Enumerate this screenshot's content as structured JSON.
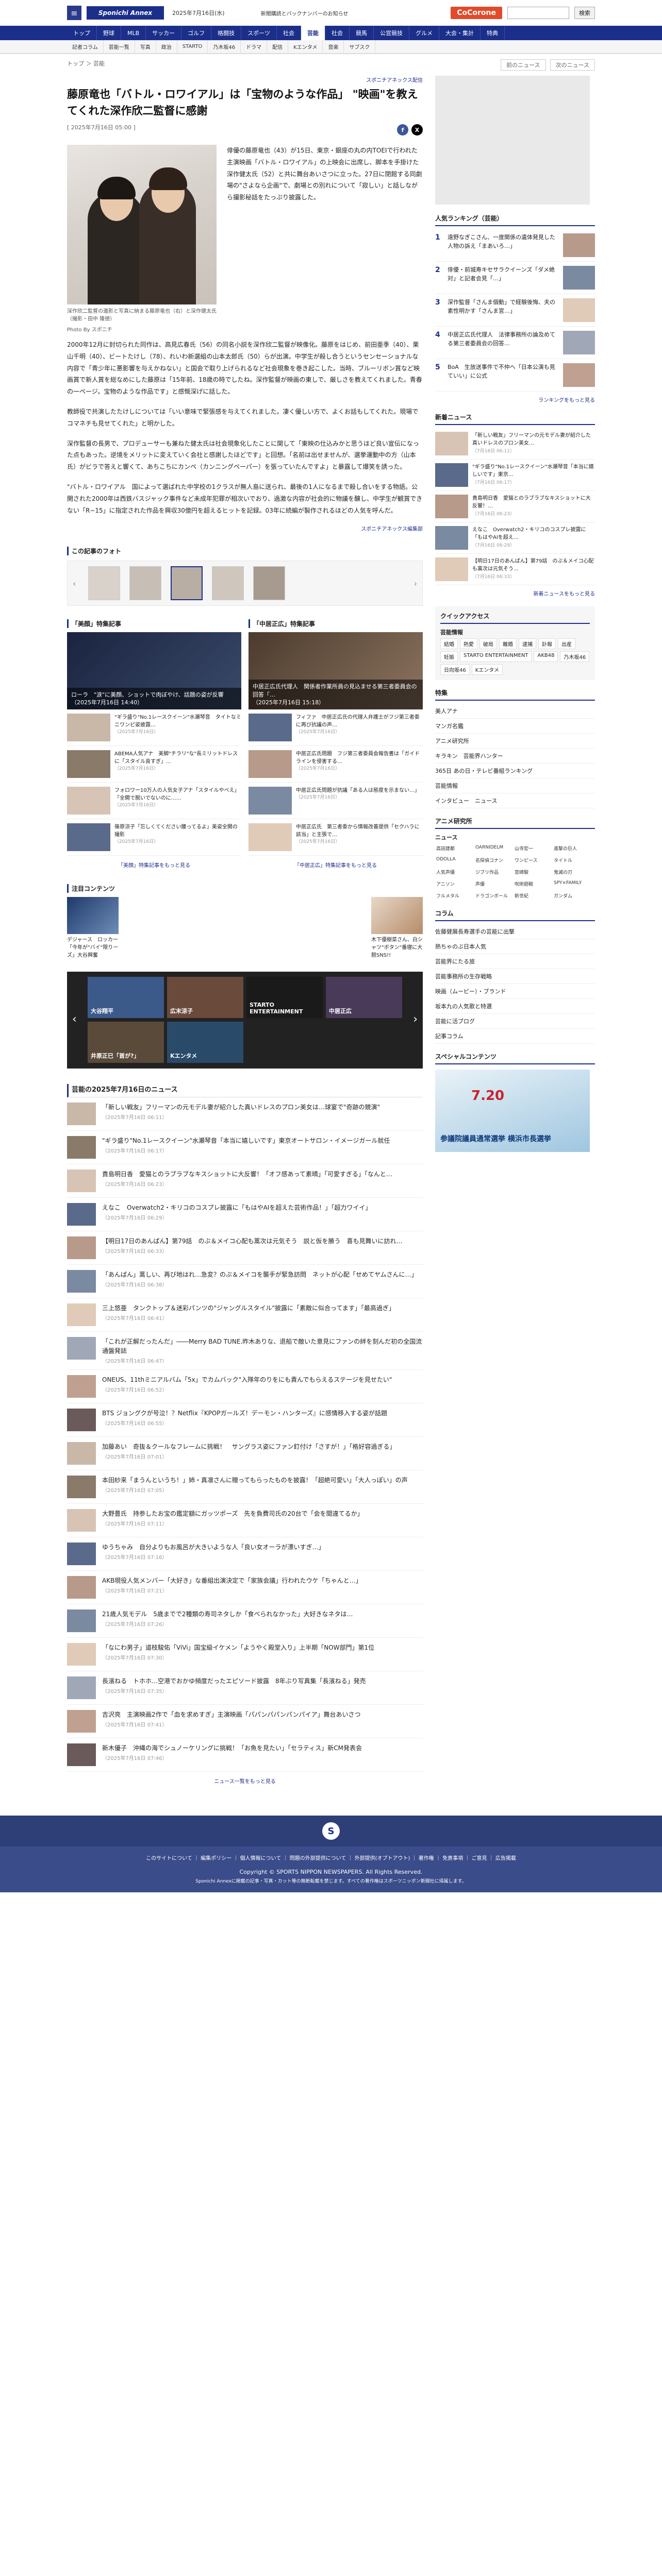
{
  "header": {
    "logo": "Sponichi Annex",
    "date": "2025年7月16日(水)",
    "promo": "新聞購読とバックナンバーのお知らせ",
    "cocorone": "CoCorone",
    "search_label": "検索"
  },
  "nav_main": [
    "トップ",
    "野球",
    "MLB",
    "サッカー",
    "ゴルフ",
    "格闘技",
    "スポーツ",
    "社会",
    "芸能",
    "社会",
    "競馬",
    "公営競技",
    "グルメ",
    "大会・集計",
    "特典"
  ],
  "nav_sub": [
    "記者コラム",
    "芸能一覧",
    "写真",
    "政治",
    "STARTO",
    "乃木坂46",
    "ドラマ",
    "配信",
    "Kエンタメ",
    "音楽",
    "サブスク"
  ],
  "breadcrumb": "トップ ＞ 芸能",
  "pager": {
    "prev": "前のニュース",
    "next": "次のニュース"
  },
  "article": {
    "sponsor": "スポニチアネックス配信",
    "title": "藤原竜也「バトル・ロワイアル」は「宝物のような作品」 \"映画\"を教えてくれた深作欣二監督に感謝",
    "date": "[ 2025年7月16日 05:00 ]",
    "caption": "深作欣二監督の遺影と写真に納まる藤原竜也（右）と深作健太氏（撮影・田中 隆徳）",
    "photo_by": "Photo By スポニチ",
    "paragraphs": [
      "俳優の藤原竜也（43）が15日、東京・銀座の丸の内TOEIで行われた主演映画「バトル・ロワイアル」の上映会に出席し、脚本を手掛けた深作健太氏（52）と共に舞台あいさつに立った。27日に閉館する同劇場の\"さよなら企画\"で、劇場との別れについて「寂しい」と話しながら撮影秘話をたっぷり披露した。",
      "2000年12月に封切られた同作は、高見広春氏（56）の同名小説を深作欣二監督が映像化。藤原をはじめ、前田亜季（40）、栗山千明（40）、ビートたけし（78）、れいわ新選組の山本太郎氏（50）らが出演。中学生が殺し合うというセンセーショナルな内容で「青少年に悪影響を与えかねない」と国会で取り上げられるなど社会現象を巻き起こした。当時、ブルーリボン賞など映画賞で新人賞を総なめにした藤原は「15年前、18歳の時でしたね。深作監督が映画の東しで、厳しさを教えてくれました。青春の一ページ。宝物のような作品です」と感慨深げに話した。",
      "教師役で共演したたけしについては「いい意味で緊張感を与えてくれました。凄く優しい方で、よくお話もしてくれた。現場でコマネチも見せてくれた」と明かした。",
      "深作監督の長男で、プロデューサーも兼ねた健太氏は社会現象化したことに関して「東映の仕込みかと思うほど良い宣伝になった点もあった。逆境をメリットに変えていく会社と感謝したほどです」と回想。「名前は出せませんが、選挙運動中の方（山本氏）がビラで答えと響くて、あちこちにカンペ（カンニングペーパー）を張っていたんですよ」と暴露して爆笑を誘った。",
      "\"バトル・ロワイアル　国によって選ばれた中学校の1クラスが無人島に送られ、最後の1人になるまで殺し合いをする物語。公開された2000年は西鉄バスジャック事件など未成年犯罪が相次いでおり、過激な内容が社会的に物議を醸し、中学生が観賞できない「R−15」に指定された作品を興収30億円を超えるヒットを記録。03年に続編が製作されるほどの人気を呼んだ。"
    ],
    "credit": "スポニチアネックス編集部"
  },
  "gallery": {
    "heading": "この記事のフォト"
  },
  "features": [
    {
      "heading": "「美顔」特集記事",
      "main_caption": "ローラ　\"涙\"に美顔、ショットで肉ぼやけ、話題の姿が反響",
      "main_date": "（2025年7月16日 14:40）",
      "items": [
        {
          "text": "\"ギラ盛り\"No.1レースクイーン\"水瀬琴音　タイトなミニワンピ姿披露…",
          "date": "（2025年7月16日）"
        },
        {
          "text": "ABEMA人気アナ　美脚\"チラリ\"な\"長ミリットドレスに「スタイル良すぎ」…",
          "date": "（2025年7月16日）"
        },
        {
          "text": "フォロワー10万人の人気女子アナ「スタイルやべえ」「全開で脱いでないのに……",
          "date": "（2025年7月16日）"
        },
        {
          "text": "篠原涼子「忘しくてください腰ってるよ」美姿全開の撮影",
          "date": "（2025年7月16日）"
        }
      ],
      "more": "「美顔」特集記事をもっと見る"
    },
    {
      "heading": "「中居正広」特集記事",
      "main_caption": "中居正広氏代理人　関係者作業所員の見込ませる第三者委員会の回答「…",
      "main_date": "（2025年7月16日 15:18）",
      "items": [
        {
          "text": "フィファ　中居正広氏の代理人弁護士がフジ第三者委に再び抗議の声…",
          "date": "（2025年7月16日）"
        },
        {
          "text": "中居正広氏問題　フジ第三者委員会報告書は「ガイドラインを侵害する…",
          "date": "（2025年7月16日）"
        },
        {
          "text": "中居正広氏問題が抗議「ある人は態度を示まない…」",
          "date": "（2025年7月16日）"
        },
        {
          "text": "中居正広氏　第三者委から情報改善提供「セクハラに該当」と主張で…",
          "date": "（2025年7月16日）"
        }
      ],
      "more": "「中居正広」特集記事をもっと見る"
    }
  ],
  "attention": {
    "heading": "注目コンテンツ",
    "items": [
      {
        "text": "デジャース　ロッカー「今年が\"バイ\"限りーズ」大谷興奮"
      },
      {
        "text": "木下優樹菜さん、白シャツ\"ボタン\"番寝に大胆SNS!!"
      }
    ]
  },
  "carousel": [
    "大谷翔平",
    "広末涼子",
    "STARTO ENTERTAINMENT",
    "中居正広",
    "井原正巳「首が?」",
    "Kエンタメ"
  ],
  "news": {
    "heading": "芸能の2025年7月16日のニュース",
    "items": [
      {
        "text": "「新しい戦友」フリーマンの元モデル妻が紹介した真いドレスのプロン美女は…球宴で\"奇跡の競演\"",
        "date": "（2025年7月16日 06:11）"
      },
      {
        "text": "\"ギラ盛り\"No.1レースクイーン\"水瀬琴音「本当に嬉しいです」東京オートサロン・イメージガール就任",
        "date": "（2025年7月16日 06:17）"
      },
      {
        "text": "貴島明日香　愛猫とのラブラブなキスショットに大反響！「オフ感あって素晴」「可愛すぎる」「なんと…",
        "date": "（2025年7月16日 06:23）"
      },
      {
        "text": "えなこ　Overwatch2・キリコのコスプレ披露に「もはやAIを超えた芸術作品！」「超力ワイイ」",
        "date": "（2025年7月16日 06:29）"
      },
      {
        "text": "【明日17日のあんぱん】第79話　のぶ＆メイコ心配も蒿次は元気そう　説と仮を勝う　喜も見舞いに訪れ…",
        "date": "（2025年7月16日 06:33）"
      },
      {
        "text": "「あんぱん」蒿しい、再び地はれ…急変？のぶ＆メイコを襲手が緊急訪問　ネットが心配「せめてヤムさんに…」",
        "date": "（2025年7月16日 06:38）"
      },
      {
        "text": "三上悠亜　タンクトップ＆迷彩パンツの\"ジャングルスタイル\"披露に「素敵に似合ってます」「最高過ぎ」",
        "date": "（2025年7月16日 06:41）"
      },
      {
        "text": "「これが正解だったんだ」――Merry BAD TUNE.昨木ありな、退船で敵いた意見にファンの絆を刻んだ初の全国流通盤発誌",
        "date": "（2025年7月16日 06:47）"
      },
      {
        "text": "ONEUS、11thミニアルバム「5x」でカムバック\"入隊年のりをにも責んでもらえるステージを見せたい\"",
        "date": "（2025年7月16日 06:52）"
      },
      {
        "text": "BTS ジョングクが号泣！？Netflix『KPOPガールズ！デーモン・ハンターズ』に感情移入する姿が話題",
        "date": "（2025年7月16日 06:55）"
      },
      {
        "text": "加藤あい　奇抜＆クールなフレームに挑戦！　サングラス姿にファン釘付け「さすが！」「格好容過ぎる」",
        "date": "（2025年7月16日 07:01）"
      },
      {
        "text": "本田紗来「まうんというち！」姉・真凛さんに贈ってもらったものを披露！「超絶可愛い」「大人っぽい」の声",
        "date": "（2025年7月16日 07:05）"
      },
      {
        "text": "大野豊氏　持参したお宝の鑑定額にガッツポーズ　先を負費司氏の20台で「会を間違てるか」",
        "date": "（2025年7月16日 07:11）"
      },
      {
        "text": "ゆうちゃみ　自分よりもお風呂が大きいような人「良い女オーラが漂いすぎ…」",
        "date": "（2025年7月16日 07:16）"
      },
      {
        "text": "AKB現役人気メンバー「大好き」な番組出演決定で「家族会議」行われたウケ「ちゃんと…」",
        "date": "（2025年7月16日 07:21）"
      },
      {
        "text": "21歳人気モデル　5歳までで2種類の寿司ネタしか「食べられなかった」大好きなネタは…",
        "date": "（2025年7月16日 07:26）"
      },
      {
        "text": "「なにわ男子」道枝駿佑「ViVi」国宝級イケメン「ようやく殿堂入り」上半期「NOW部門」第1位",
        "date": "（2025年7月16日 07:30）"
      },
      {
        "text": "長濱ねる　トホホ…空港でおかゆ頻度だったエピソード披露　8年ぶり写真集「長濱ねる」発売",
        "date": "（2025年7月16日 07:35）"
      },
      {
        "text": "吉沢亮　主演映画2作で「血を求めすぎ」主演映画「パパンパパンパンパイア」舞台あいさつ",
        "date": "（2025年7月16日 07:41）"
      },
      {
        "text": "新木優子　沖縄の海でシュノーケリングに挑戦！「お魚を見たい」「セラティス」新CM発表会",
        "date": "（2025年7月16日 07:46）"
      }
    ],
    "more": "ニュース一覧をもっと見る"
  },
  "sidebar": {
    "ranking": {
      "heading": "人気ランキング（芸能）",
      "items": [
        "遠野なぎこさん、一度関係の遺体発見した人物の訴え「まあいろ…」",
        "俳優・前城寿キセサラクイーンズ「ダメ絶対」と記者会見「…」",
        "深作監督「さんま個動」で経験後悔、夫の素性明かす「さんま宮…」",
        "中居正広氏代理人　法律事務所の論及めてる第三者委員会の回答…",
        "BoA　生放送事件で不仲へ「日本公演も見ていい」に公式"
      ],
      "more": "ランキングをもっと見る"
    },
    "latest": {
      "heading": "新着ニュース",
      "items": [
        {
          "text": "「新しい戦友」フリーマンの元モデル妻が紹介した真いドレスのプロン美女…",
          "date": "（7月16日 06:11）"
        },
        {
          "text": "\"ギラ盛り\"No.1レースクイーン\"水瀬琴音「本当に嬉しいです」東京…",
          "date": "（7月16日 06:17）"
        },
        {
          "text": "貴島明日香　愛猫とのラブラブなキスショットに大反響！…",
          "date": "（7月16日 06:23）"
        },
        {
          "text": "えなこ　Overwatch2・キリコのコスプレ披露に「もはやAIを超え…",
          "date": "（7月16日 06:29）"
        },
        {
          "text": "【明日17日のあんぱん】第79話　のぶ＆メイコ心配も蒿次は元気そう…",
          "date": "（7月16日 06:33）"
        }
      ],
      "more": "新着ニュースをもっと見る"
    },
    "quick": {
      "heading": "クイックアクセス",
      "sub": "芸能情報",
      "tags": [
        "結婚",
        "熱愛",
        "破局",
        "離婚",
        "逮捕",
        "訃報",
        "出産",
        "妊娠",
        "STARTO ENTERTAINMENT",
        "AKB48",
        "乃木坂46",
        "日向坂46",
        "Kエンタメ"
      ]
    },
    "special": {
      "heading": "特集",
      "items": [
        "美人アナ",
        "マンガ名鑑",
        "アニメ研究所",
        "キラキン　芸能界ハンター",
        "365日 あの日・テレビ番組ランキング",
        "芸能情報"
      ]
    },
    "interview": "インタビュー　ニュース",
    "anime": {
      "heading": "アニメ研究所",
      "sub": "ニュース",
      "tags": [
        "高田建都",
        "OARNIDELM",
        "山寺宏一",
        "進撃の巨人",
        "ODOLLA",
        "名探偵コナン",
        "ワンピース",
        "タイトル",
        "人気声優",
        "ジブリ作品",
        "宮崎駿",
        "鬼滅の刃",
        "アニソン",
        "声優",
        "呪術廻戦",
        "SPY×FAMILY",
        "フルメタル",
        "ドラゴンボール",
        "新世紀",
        "ガンダム"
      ]
    },
    "column": {
      "heading": "コラム",
      "items": [
        "佐藤健展長寿選手の芸能に出撃",
        "熱ちゃのぶ日本人気",
        "芸能界にたる旅",
        "芸能事務所の生存戦略",
        "映画（ムービー）・ブランド",
        " 坂本九の人気歌と特選",
        "芸能に活ブログ",
        "記事コラム"
      ]
    },
    "sp_content": {
      "heading": "スペシャルコンテンツ",
      "banner_big": "7.20",
      "banner_text": "参議院議員通常選挙 横浜市長選挙"
    }
  },
  "footer": {
    "logo": "S",
    "links": "このサイトについて ｜ 編集ポリシー ｜ 個人情報について ｜ 問題の外部提供について ｜ 外部提供(オプトアウト) ｜ 著作権 ｜ 免責事項 ｜ ご意見 ｜ 広告掲載",
    "copy": "Copyright © SPORTS NIPPON NEWSPAPERS. All Rights Reserved.",
    "sub": "Sponichi Annexに掲載の記事・写真・カット等の無断転載を禁じます。すべての著作権はスポーツニッポン新聞社に帰属します。"
  }
}
